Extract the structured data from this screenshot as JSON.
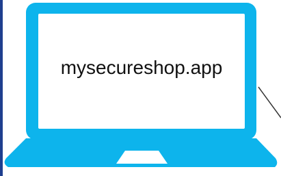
{
  "illustration": {
    "screen_text": "mysecureshop.app"
  },
  "colors": {
    "laptop_body": "#0DB4EC",
    "screen": "#FFFFFF",
    "left_edge_bar": "#1F3F8F",
    "text": "#111111",
    "connector_line": "#333333"
  },
  "icon": "laptop-icon"
}
